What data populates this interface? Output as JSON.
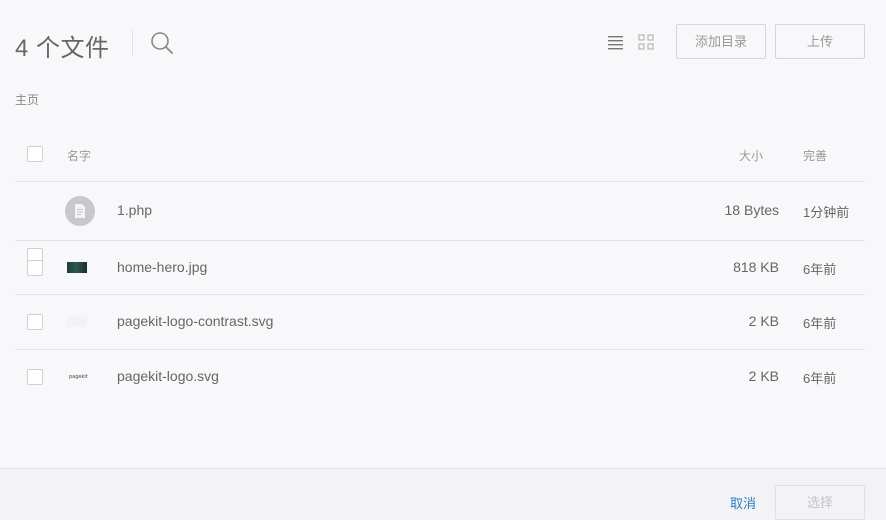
{
  "header": {
    "title": "4 个文件",
    "add_dir_label": "添加目录",
    "upload_label": "上传",
    "search_icon": "search-icon",
    "list_view_icon": "list-view-icon",
    "grid_view_icon": "grid-view-icon"
  },
  "breadcrumb": {
    "home": "主页"
  },
  "table": {
    "headers": {
      "name": "名字",
      "size": "大小",
      "modified": "完善"
    },
    "rows": [
      {
        "name": "1.php",
        "size": "18 Bytes",
        "modified": "1分钟前",
        "icon": "file-icon"
      },
      {
        "name": "home-hero.jpg",
        "size": "818 KB",
        "modified": "6年前",
        "icon": "image-thumbnail"
      },
      {
        "name": "pagekit-logo-contrast.svg",
        "size": "2 KB",
        "modified": "6年前",
        "icon": "image-thumbnail"
      },
      {
        "name": "pagekit-logo.svg",
        "size": "2 KB",
        "modified": "6年前",
        "icon": "image-thumbnail",
        "thumb_text": "pagekit"
      }
    ]
  },
  "footer": {
    "cancel_label": "取消",
    "select_label": "选择"
  },
  "colors": {
    "accent": "#2b7fc3",
    "background": "#f8f8fa",
    "footer_bg": "#f3f3f5"
  }
}
